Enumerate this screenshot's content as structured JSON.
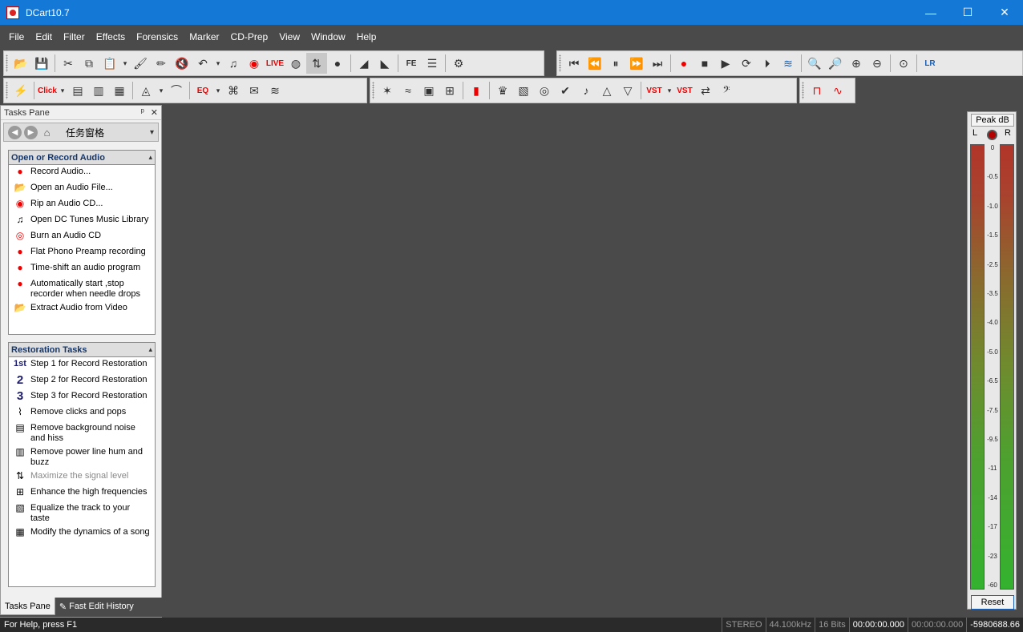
{
  "window": {
    "title": "DCart10.7",
    "minimize": "—",
    "maximize": "☐",
    "close": "✕"
  },
  "menu": [
    "File",
    "Edit",
    "Filter",
    "Effects",
    "Forensics",
    "Marker",
    "CD-Prep",
    "View",
    "Window",
    "Help"
  ],
  "toolbar": {
    "live_label": "LIVE",
    "click_label": "Click",
    "eq_label": "EQ",
    "fe_label": "FE",
    "vst1_label": "VST",
    "vst2_label": "VST",
    "lr_label": "LR"
  },
  "tasks_pane": {
    "caption": "Tasks Pane",
    "pin": "ᵖ",
    "close": "✕",
    "nav_title": "任务窗格",
    "sections": [
      {
        "title": "Open or Record Audio",
        "items": [
          {
            "label": "Record Audio...",
            "icon": "record-icon"
          },
          {
            "label": "Open an Audio File...",
            "icon": "folder-open-icon"
          },
          {
            "label": "Rip an Audio CD...",
            "icon": "cd-rip-icon"
          },
          {
            "label": "Open DC Tunes Music Library",
            "icon": "music-library-icon"
          },
          {
            "label": "Burn an Audio CD",
            "icon": "cd-burn-icon"
          },
          {
            "label": "Flat Phono Preamp recording",
            "icon": "record-icon"
          },
          {
            "label": "Time-shift an audio program",
            "icon": "record-icon"
          },
          {
            "label": "Automatically start ,stop recorder when needle drops",
            "icon": "record-icon"
          },
          {
            "label": "Extract Audio from Video",
            "icon": "folder-open-icon"
          }
        ]
      },
      {
        "title": "Restoration Tasks",
        "items": [
          {
            "label": "Step 1 for Record Restoration",
            "icon": "step-1-icon",
            "glyph": "1st"
          },
          {
            "label": "Step 2 for Record Restoration",
            "icon": "step-2-icon",
            "glyph": "2"
          },
          {
            "label": "Step 3 for Record Restoration",
            "icon": "step-3-icon",
            "glyph": "3"
          },
          {
            "label": "Remove clicks and pops",
            "icon": "declick-icon"
          },
          {
            "label": "Remove background noise and hiss",
            "icon": "noise-icon"
          },
          {
            "label": "Remove power line hum and buzz",
            "icon": "hum-icon"
          },
          {
            "label": "Maximize the signal level",
            "icon": "maximize-icon",
            "disabled": true
          },
          {
            "label": "Enhance the high frequencies",
            "icon": "enhance-icon"
          },
          {
            "label": "Equalize the track to your taste",
            "icon": "equalize-icon"
          },
          {
            "label": "Modify the dynamics of a song",
            "icon": "dynamics-icon"
          }
        ]
      }
    ],
    "tabs": [
      "Tasks Pane",
      "Fast Edit History"
    ]
  },
  "meter": {
    "peak_label": "Peak dB",
    "left": "L",
    "right": "R",
    "scale": [
      "0",
      "-0.5",
      "-1.0",
      "-1.5",
      "-2.5",
      "-3.5",
      "-4.0",
      "-5.0",
      "-6.5",
      "-7.5",
      "-9.5",
      "-11",
      "-14",
      "-17",
      "-23",
      "-60"
    ],
    "reset": "Reset"
  },
  "status": {
    "help": "For Help, press F1",
    "channels": "STEREO",
    "rate": "44.100kHz",
    "bits": "16 Bits",
    "time1": "00:00:00.000",
    "time2": "00:00:00.000",
    "offset": "-5980688.66"
  }
}
